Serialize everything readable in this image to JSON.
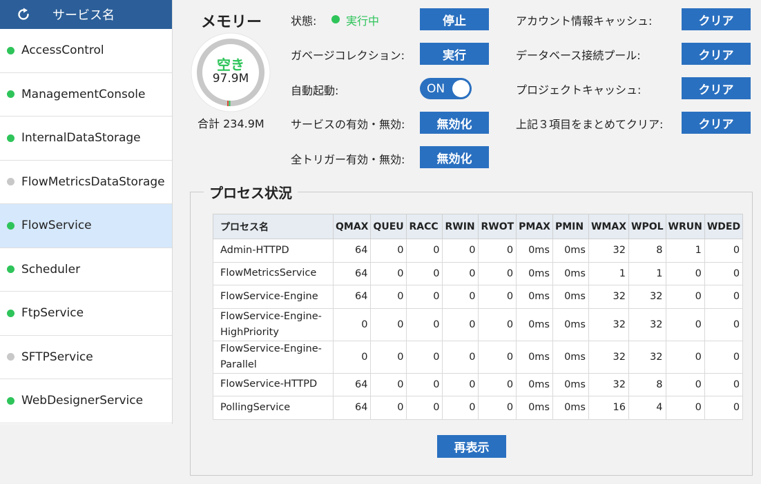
{
  "sidebar": {
    "title": "サービス名",
    "refresh_icon": "refresh-icon",
    "items": [
      {
        "label": "AccessControl",
        "status": "green"
      },
      {
        "label": "ManagementConsole",
        "status": "green"
      },
      {
        "label": "InternalDataStorage",
        "status": "green"
      },
      {
        "label": "FlowMetricsDataStorage",
        "status": "gray"
      },
      {
        "label": "FlowService",
        "status": "green",
        "selected": true
      },
      {
        "label": "Scheduler",
        "status": "green"
      },
      {
        "label": "FtpService",
        "status": "green"
      },
      {
        "label": "SFTPService",
        "status": "gray"
      },
      {
        "label": "WebDesignerService",
        "status": "green"
      }
    ]
  },
  "memory": {
    "title": "メモリー",
    "free_label": "空き",
    "free_value": "97.9M",
    "total_label": "合計 234.9M",
    "free_fraction": 0.417
  },
  "controls": {
    "status_label": "状態:",
    "status_value": "実行中",
    "stop_button": "停止",
    "gc_label": "ガベージコレクション:",
    "gc_button": "実行",
    "autostart_label": "自動起動:",
    "autostart_toggle": "ON",
    "service_toggle_label": "サービスの有効・無効:",
    "service_toggle_button": "無効化",
    "trigger_toggle_label": "全トリガー有効・無効:",
    "trigger_toggle_button": "無効化",
    "account_cache_label": "アカウント情報キャッシュ:",
    "account_cache_button": "クリア",
    "db_pool_label": "データベース接続プール:",
    "db_pool_button": "クリア",
    "project_cache_label": "プロジェクトキャッシュ:",
    "project_cache_button": "クリア",
    "clear_all_label": "上記３項目をまとめてクリア:",
    "clear_all_button": "クリア"
  },
  "process": {
    "title": "プロセス状況",
    "columns": [
      "プロセス名",
      "QMAX",
      "QUEU",
      "RACC",
      "RWIN",
      "RWOT",
      "PMAX",
      "PMIN",
      "WMAX",
      "WPOL",
      "WRUN",
      "WDED"
    ],
    "rows": [
      [
        "Admin-HTTPD",
        "64",
        "0",
        "0",
        "0",
        "0",
        "0ms",
        "0ms",
        "32",
        "8",
        "1",
        "0"
      ],
      [
        "FlowMetricsService",
        "64",
        "0",
        "0",
        "0",
        "0",
        "0ms",
        "0ms",
        "1",
        "1",
        "0",
        "0"
      ],
      [
        "FlowService-Engine",
        "64",
        "0",
        "0",
        "0",
        "0",
        "0ms",
        "0ms",
        "32",
        "32",
        "0",
        "0"
      ],
      [
        "FlowService-Engine-HighPriority",
        "0",
        "0",
        "0",
        "0",
        "0",
        "0ms",
        "0ms",
        "32",
        "32",
        "0",
        "0"
      ],
      [
        "FlowService-Engine-Parallel",
        "0",
        "0",
        "0",
        "0",
        "0",
        "0ms",
        "0ms",
        "32",
        "32",
        "0",
        "0"
      ],
      [
        "FlowService-HTTPD",
        "64",
        "0",
        "0",
        "0",
        "0",
        "0ms",
        "0ms",
        "32",
        "8",
        "0",
        "0"
      ],
      [
        "PollingService",
        "64",
        "0",
        "0",
        "0",
        "0",
        "0ms",
        "0ms",
        "16",
        "4",
        "0",
        "0"
      ]
    ],
    "reload_button": "再表示"
  }
}
